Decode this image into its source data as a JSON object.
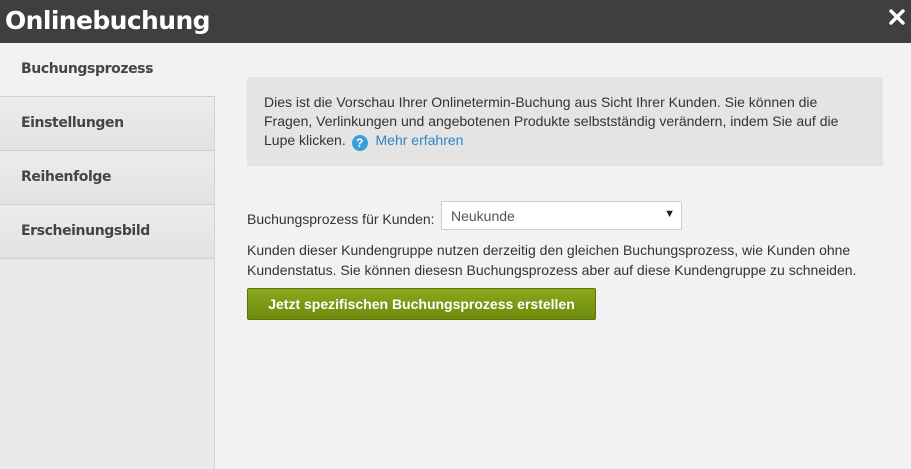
{
  "window": {
    "title": "Onlinebuchung",
    "close_icon": "close-icon"
  },
  "sidebar": {
    "items": [
      {
        "label": "Buchungsprozess",
        "active": true
      },
      {
        "label": "Einstellungen",
        "active": false
      },
      {
        "label": "Reihenfolge",
        "active": false
      },
      {
        "label": "Erscheinungsbild",
        "active": false
      }
    ],
    "active_indicator": "›"
  },
  "info": {
    "text": "Dies ist die Vorschau Ihrer Onlinetermin-Buchung aus Sicht Ihrer Kunden. Sie können die Fragen, Verlinkungen und angebotenen Produkte selbstständig verändern, indem Sie auf die Lupe klicken.",
    "help_icon_glyph": "?",
    "link_label": "Mehr erfahren"
  },
  "form": {
    "label": "Buchungsprozess für Kunden:",
    "select_value": "Neukunde",
    "select_arrow": "▼"
  },
  "description": "Kunden dieser Kundengruppe nutzen derzeitig den gleichen Buchungsprozess, wie Kunden ohne Kundenstatus. Sie können diesesn Buchungsprozess aber auf diese Kundengruppe zu schneiden.",
  "button_label": "Jetzt spezifischen Buchungsprozess erstellen",
  "colors": {
    "titlebar": "#3f3f3f",
    "button": "#7a961a",
    "link": "#2a86c5",
    "help_icon": "#3a9fd8"
  }
}
